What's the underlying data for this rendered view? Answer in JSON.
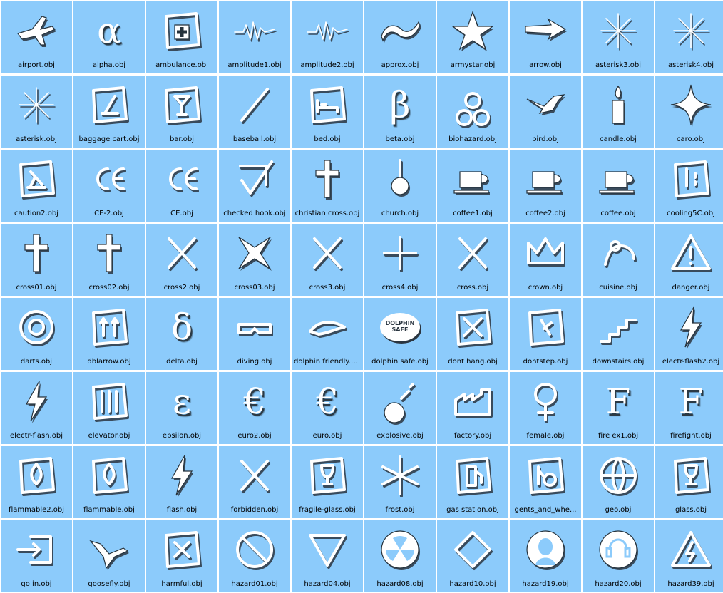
{
  "colors": {
    "tile_background": "#8ccbfb",
    "page_background": "#ffffff",
    "label": "#000000",
    "glyph": "#ffffff",
    "glyph_shadow": "#2a3540"
  },
  "tiles": [
    {
      "label": "airport.obj",
      "icon": "plane-icon"
    },
    {
      "label": "alpha.obj",
      "icon": "alpha-icon",
      "glyph": "α"
    },
    {
      "label": "ambulance.obj",
      "icon": "ambulance-icon"
    },
    {
      "label": "amplitude1.obj",
      "icon": "amplitude-icon"
    },
    {
      "label": "amplitude2.obj",
      "icon": "amplitude-icon"
    },
    {
      "label": "approx.obj",
      "icon": "tilde-icon"
    },
    {
      "label": "armystar.obj",
      "icon": "star-icon"
    },
    {
      "label": "arrow.obj",
      "icon": "arrow-icon"
    },
    {
      "label": "asterisk3.obj",
      "icon": "asterisk-icon"
    },
    {
      "label": "asterisk4.obj",
      "icon": "asterisk-icon"
    },
    {
      "label": "asterisk.obj",
      "icon": "asterisk-icon"
    },
    {
      "label": "baggage cart.obj",
      "icon": "baggage-cart-icon"
    },
    {
      "label": "bar.obj",
      "icon": "bar-icon"
    },
    {
      "label": "baseball.obj",
      "icon": "baseball-bat-icon"
    },
    {
      "label": "bed.obj",
      "icon": "bed-icon"
    },
    {
      "label": "beta.obj",
      "icon": "beta-icon",
      "glyph": "β"
    },
    {
      "label": "biohazard.obj",
      "icon": "biohazard-icon"
    },
    {
      "label": "bird.obj",
      "icon": "bird-icon"
    },
    {
      "label": "candle.obj",
      "icon": "candle-icon"
    },
    {
      "label": "caro.obj",
      "icon": "diamond-icon"
    },
    {
      "label": "caution2.obj",
      "icon": "caution-icon"
    },
    {
      "label": "CE-2.obj",
      "icon": "ce-mark-icon"
    },
    {
      "label": "CE.obj",
      "icon": "ce-mark-icon"
    },
    {
      "label": "checked hook.obj",
      "icon": "checkmark-icon"
    },
    {
      "label": "christian cross.obj",
      "icon": "cross-icon"
    },
    {
      "label": "church.obj",
      "icon": "church-icon"
    },
    {
      "label": "coffee1.obj",
      "icon": "coffee-cup-icon"
    },
    {
      "label": "coffee2.obj",
      "icon": "coffee-cup-icon"
    },
    {
      "label": "coffee.obj",
      "icon": "coffee-cup-icon"
    },
    {
      "label": "cooling5C.obj",
      "icon": "thermometer-icon"
    },
    {
      "label": "cross01.obj",
      "icon": "cross-icon"
    },
    {
      "label": "cross02.obj",
      "icon": "cross-icon"
    },
    {
      "label": "cross2.obj",
      "icon": "x-mark-icon"
    },
    {
      "label": "cross03.obj",
      "icon": "maltese-cross-icon"
    },
    {
      "label": "cross3.obj",
      "icon": "x-mark-icon"
    },
    {
      "label": "cross4.obj",
      "icon": "plus-icon"
    },
    {
      "label": "cross.obj",
      "icon": "x-mark-icon"
    },
    {
      "label": "crown.obj",
      "icon": "crown-icon"
    },
    {
      "label": "cuisine.obj",
      "icon": "cuisine-hand-icon"
    },
    {
      "label": "danger.obj",
      "icon": "warning-icon"
    },
    {
      "label": "darts.obj",
      "icon": "target-icon"
    },
    {
      "label": "dblarrow.obj",
      "icon": "double-arrow-icon"
    },
    {
      "label": "delta.obj",
      "icon": "delta-icon",
      "glyph": "δ"
    },
    {
      "label": "diving.obj",
      "icon": "diving-mask-icon"
    },
    {
      "label": "dolphin friendly.obj",
      "icon": "dolphin-icon"
    },
    {
      "label": "dolphin safe.obj",
      "icon": "dolphin-icon",
      "glyph_text": [
        "DOLPHIN",
        "SAFE"
      ]
    },
    {
      "label": "dont hang.obj",
      "icon": "dont-hang-icon"
    },
    {
      "label": "dontstep.obj",
      "icon": "dont-step-icon"
    },
    {
      "label": "downstairs.obj",
      "icon": "stairs-icon"
    },
    {
      "label": "electr-flash2.obj",
      "icon": "lightning-icon"
    },
    {
      "label": "electr-flash.obj",
      "icon": "lightning-icon"
    },
    {
      "label": "elevator.obj",
      "icon": "elevator-icon"
    },
    {
      "label": "epsilon.obj",
      "icon": "epsilon-icon",
      "glyph": "ε"
    },
    {
      "label": "euro2.obj",
      "icon": "euro-icon",
      "glyph": "€"
    },
    {
      "label": "euro.obj",
      "icon": "euro-icon",
      "glyph": "€"
    },
    {
      "label": "explosive.obj",
      "icon": "bomb-icon"
    },
    {
      "label": "factory.obj",
      "icon": "factory-icon"
    },
    {
      "label": "female.obj",
      "icon": "female-icon"
    },
    {
      "label": "fire ex1.obj",
      "icon": "fire-extinguisher-icon",
      "glyph": "F"
    },
    {
      "label": "firefight.obj",
      "icon": "fire-extinguisher-icon",
      "glyph": "F"
    },
    {
      "label": "flammable2.obj",
      "icon": "flame-icon"
    },
    {
      "label": "flammable.obj",
      "icon": "flame-icon"
    },
    {
      "label": "flash.obj",
      "icon": "lightning-icon"
    },
    {
      "label": "forbidden.obj",
      "icon": "x-mark-icon"
    },
    {
      "label": "fragile-glass.obj",
      "icon": "glass-icon"
    },
    {
      "label": "frost.obj",
      "icon": "snowflake-icon"
    },
    {
      "label": "gas station.obj",
      "icon": "gas-pump-icon"
    },
    {
      "label": "gents_and_whe...",
      "icon": "wheelchair-icon"
    },
    {
      "label": "geo.obj",
      "icon": "globe-icon"
    },
    {
      "label": "glass.obj",
      "icon": "glass-icon"
    },
    {
      "label": "go in.obj",
      "icon": "enter-icon"
    },
    {
      "label": "goosefly.obj",
      "icon": "goose-icon"
    },
    {
      "label": "harmful.obj",
      "icon": "harmful-icon"
    },
    {
      "label": "hazard01.obj",
      "icon": "no-entry-icon"
    },
    {
      "label": "hazard04.obj",
      "icon": "triangle-icon"
    },
    {
      "label": "hazard08.obj",
      "icon": "radiation-icon"
    },
    {
      "label": "hazard10.obj",
      "icon": "diamond-outline-icon"
    },
    {
      "label": "hazard19.obj",
      "icon": "head-icon"
    },
    {
      "label": "hazard20.obj",
      "icon": "ear-protection-icon"
    },
    {
      "label": "hazard39.obj",
      "icon": "high-voltage-icon"
    }
  ]
}
